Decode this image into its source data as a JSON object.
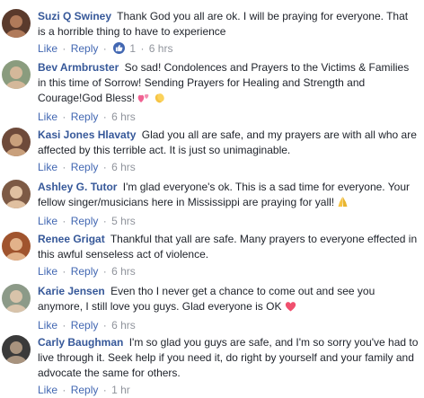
{
  "actions": {
    "like": "Like",
    "reply": "Reply",
    "dot": "·"
  },
  "comments": [
    {
      "author": "Suzi Q Swiney",
      "text": "Thank God you all are ok. I will be praying for everyone. That is a horrible thing to have to experience",
      "time": "6 hrs",
      "reactions": "1",
      "avatar_colors": [
        "#5a3a2c",
        "#b07a5a"
      ]
    },
    {
      "author": "Bev Armbruster",
      "text": "So sad! Condolences and Prayers to the Victims & Families in this time of Sorrow! Sending Prayers for Healing and Strength and Courage!God Bless!",
      "time": "6 hrs",
      "avatar_colors": [
        "#8a9c7e",
        "#d4b89a"
      ]
    },
    {
      "author": "Kasi Jones Hlavaty",
      "text": "Glad you all are safe, and my prayers are with all who are affected by this terrible act. It is just so unimaginable.",
      "time": "6 hrs",
      "avatar_colors": [
        "#6e4a3a",
        "#c9a07c"
      ]
    },
    {
      "author": "Ashley G. Tutor",
      "text": "I'm glad everyone's ok. This is a sad time for everyone. Your fellow singer/musicians here in Mississippi are praying for yall!",
      "time": "5 hrs",
      "avatar_colors": [
        "#7d5a45",
        "#e0c0a0"
      ]
    },
    {
      "author": "Renee Grigat",
      "text": "Thankful that yall are safe. Many prayers to everyone effected in this awful senseless act of violence.",
      "time": "6 hrs",
      "avatar_colors": [
        "#a0542e",
        "#e2b28a"
      ]
    },
    {
      "author": "Karie Jensen",
      "text": "Even tho I never get a chance to come out and see you anymore, I still love you guys. Glad everyone is OK",
      "time": "6 hrs",
      "avatar_colors": [
        "#8c9a88",
        "#d8c3aa"
      ]
    },
    {
      "author": "Carly Baughman",
      "text": "I'm so glad you guys are safe, and I'm so sorry you've had to live through it. Seek help if you need it, do right by yourself and your family and advocate the same for others.",
      "time": "1 hr",
      "avatar_colors": [
        "#3a3a3a",
        "#a8937e"
      ]
    }
  ]
}
